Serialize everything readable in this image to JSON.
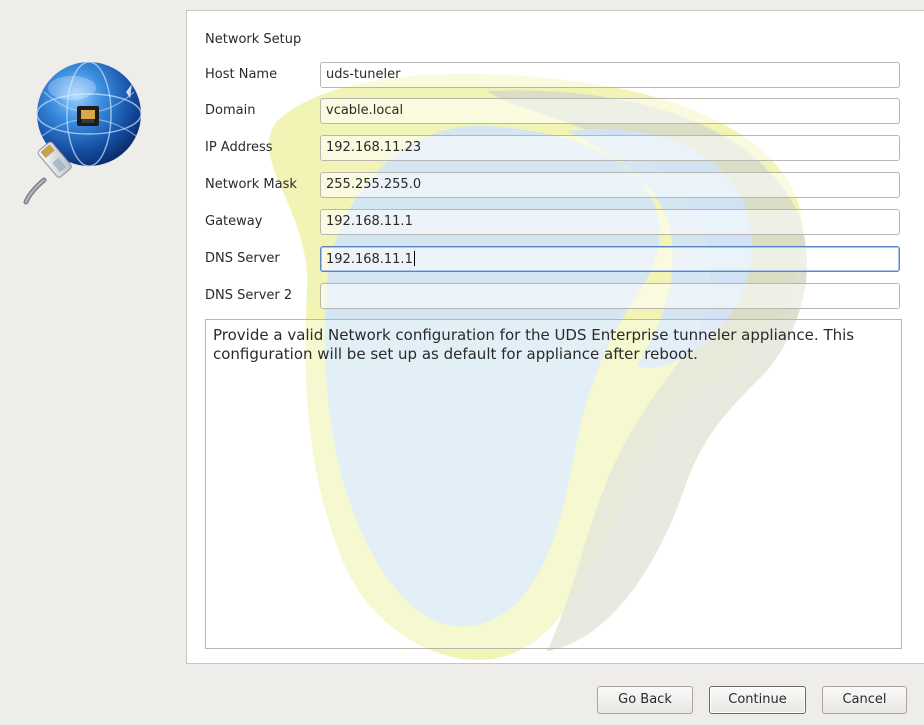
{
  "section_title": "Network Setup",
  "fields": [
    {
      "label": "Host Name",
      "value": "uds-tuneler"
    },
    {
      "label": "Domain",
      "value": "vcable.local"
    },
    {
      "label": "IP Address",
      "value": "192.168.11.23"
    },
    {
      "label": "Network Mask",
      "value": "255.255.255.0"
    },
    {
      "label": "Gateway",
      "value": "192.168.11.1"
    },
    {
      "label": "DNS Server",
      "value": "192.168.11.1"
    },
    {
      "label": "DNS Server 2",
      "value": ""
    }
  ],
  "description": "Provide a valid Network configuration for the UDS Enterprise tunneler appliance. This configuration will be set up as default for appliance after reboot.",
  "buttons": {
    "go_back": "Go Back",
    "continue": "Continue",
    "cancel": "Cancel"
  },
  "icons": {
    "side": "network-globe-icon",
    "watermark": "uds-logo-watermark"
  },
  "colors": {
    "focus_border": "#5a87c6",
    "globe_blue": "#1f5fb0",
    "watermark_yellow": "#eef2a8",
    "watermark_blue": "#cfe3fb"
  }
}
